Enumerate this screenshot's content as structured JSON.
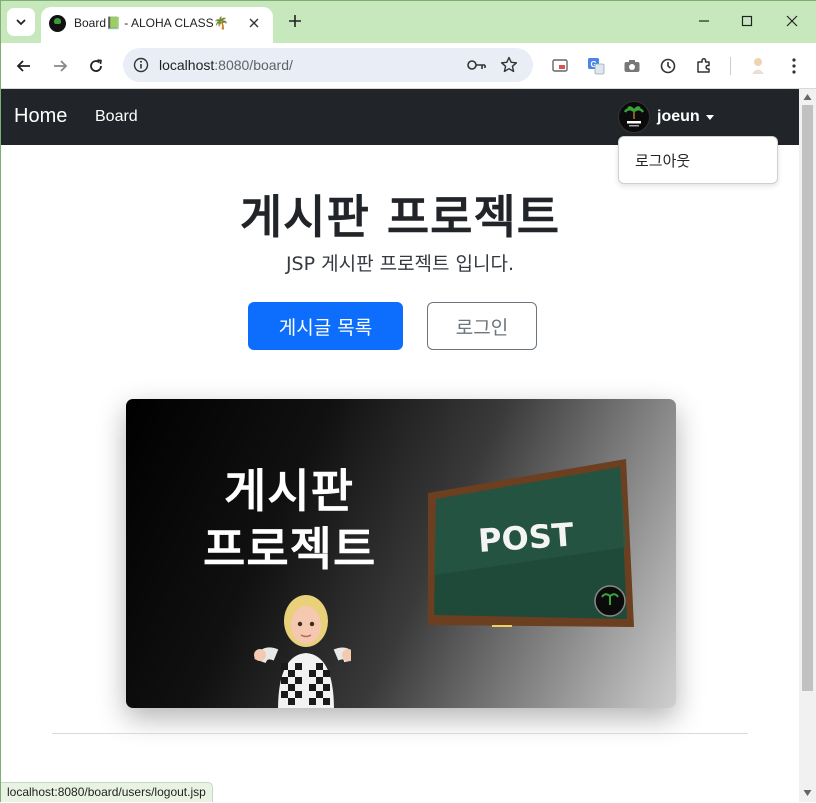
{
  "browser": {
    "tab_title": "Board📗 - ALOHA CLASS🌴",
    "url_host": "localhost",
    "url_rest": ":8080/board/",
    "status_url": "localhost:8080/board/users/logout.jsp"
  },
  "navbar": {
    "home_label": "Home",
    "board_label": "Board",
    "username": "joeun",
    "dropdown_items": [
      "로그아웃"
    ]
  },
  "hero": {
    "title": "게시판 프로젝트",
    "subtitle": "JSP 게시판 프로젝트 입니다.",
    "primary_button": "게시글 목록",
    "secondary_button": "로그인"
  },
  "banner": {
    "line1": "게시판",
    "line2": "프로젝트",
    "board_text": "POST"
  },
  "colors": {
    "navbar_bg": "#212529",
    "primary": "#0d6efd",
    "tabstrip_bg": "#c7e8bd"
  }
}
